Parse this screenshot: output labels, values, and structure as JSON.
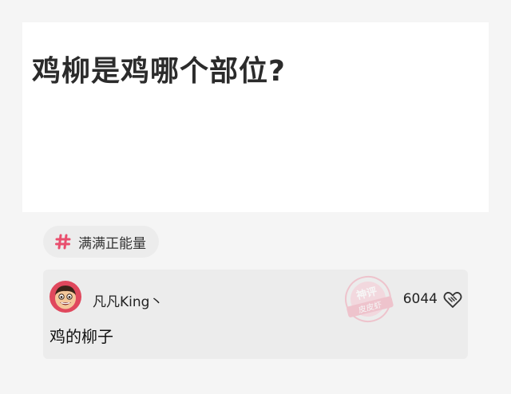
{
  "question": {
    "title": "鸡柳是鸡哪个部位?"
  },
  "topic": {
    "label": "满满正能量",
    "icon": "hash-icon",
    "color": "#e94f6e"
  },
  "answer": {
    "author": "凡凡King丶",
    "likes": "6044",
    "text": "鸡的柳子",
    "stamp_top": "神评",
    "stamp_bottom": "皮皮虾",
    "stamp_color": "#f0a3b3",
    "like_icon": "handshake-heart-icon"
  }
}
